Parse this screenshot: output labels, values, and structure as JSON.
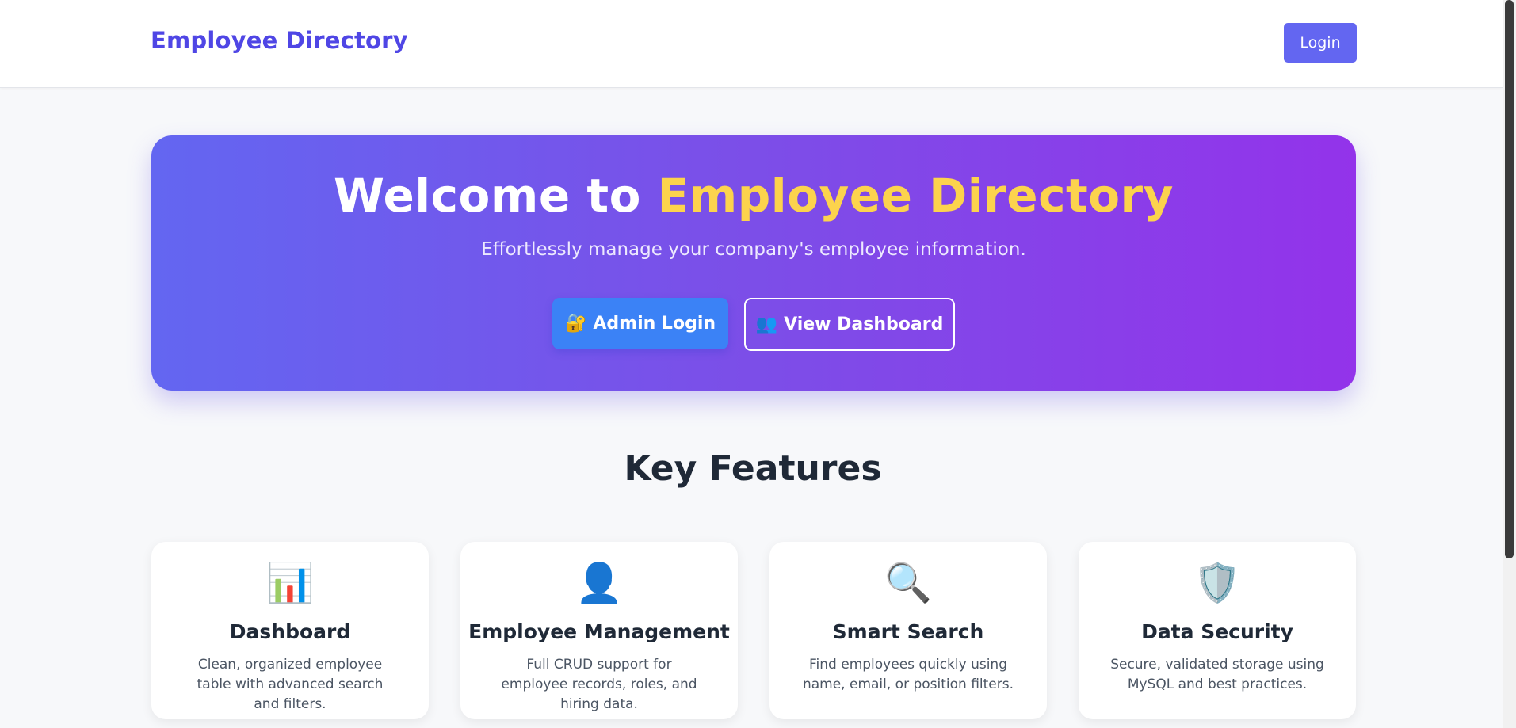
{
  "navbar": {
    "brand": "Employee Directory",
    "login_label": "Login"
  },
  "hero": {
    "title_prefix": "Welcome to ",
    "title_accent": "Employee Directory",
    "subtitle": "Effortlessly manage your company's employee information.",
    "admin_button": {
      "icon": "🔐",
      "icon_name": "lock-key-icon",
      "label": "Admin Login"
    },
    "dashboard_button": {
      "icon": "👥",
      "icon_name": "people-icon",
      "label": "View Dashboard"
    }
  },
  "features": {
    "heading": "Key Features",
    "cards": [
      {
        "icon": "📊",
        "icon_name": "bar-chart-icon",
        "title": "Dashboard",
        "description": "Clean, organized employee table with advanced search and filters."
      },
      {
        "icon": "👤",
        "icon_name": "user-icon",
        "title": "Employee Management",
        "description": "Full CRUD support for employee records, roles, and hiring data."
      },
      {
        "icon": "🔍",
        "icon_name": "magnifier-icon",
        "title": "Smart Search",
        "description": "Find employees quickly using name, email, or position filters."
      },
      {
        "icon": "🛡️",
        "icon_name": "shield-icon",
        "title": "Data Security",
        "description": "Secure, validated storage using MySQL and best practices."
      }
    ]
  },
  "colors": {
    "brand": "#4f46e5",
    "nav_button": "#6366f1",
    "hero_gradient_start": "#6366f1",
    "hero_gradient_end": "#9333ea",
    "accent_yellow": "#fcd34d",
    "admin_button": "#3b82f6"
  }
}
